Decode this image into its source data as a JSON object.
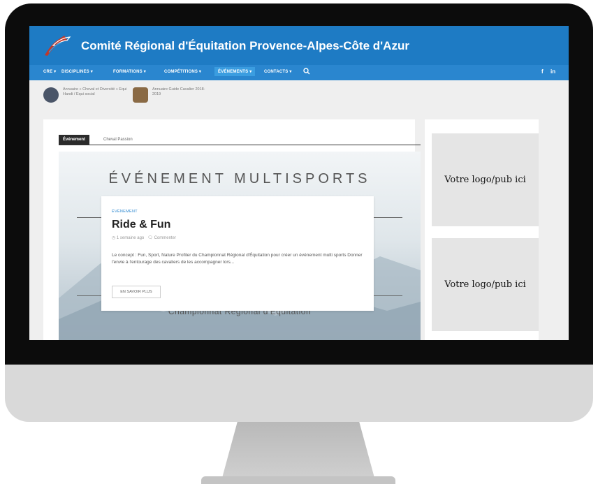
{
  "site": {
    "title": "Comité Régional d'Équitation Provence-Alpes-Côte d'Azur",
    "brand_color": "#1e7bc4"
  },
  "nav": {
    "items": [
      {
        "label": "CRE ▾",
        "active": false
      },
      {
        "label": "DISCIPLINES ▾",
        "active": false
      },
      {
        "label": "FORMATIONS ▾",
        "active": false
      },
      {
        "label": "COMPÉTITIONS ▾",
        "active": false
      },
      {
        "label": "ÉVÉNEMENTS ▾",
        "active": true
      },
      {
        "label": "CONTACTS ▾",
        "active": false
      }
    ],
    "search_icon": "search-icon",
    "social": [
      "f",
      "in"
    ]
  },
  "related": [
    {
      "text": "Annuaire « Cheval et Diversité » Equi Handi / Equi social"
    },
    {
      "text": "Annuaire Guide Cavalier 2018-2019"
    }
  ],
  "tabs": {
    "active": "Événement",
    "other": "Cheval Passion"
  },
  "hero": {
    "headline": "ÉVÉNEMENT MULTISPORTS",
    "subtitle": "Championnat Régional d'Équitation"
  },
  "post": {
    "category": "ÉVÉNEMENT",
    "title": "Ride & Fun",
    "time": "1 semaine ago",
    "comment": "Commenter",
    "excerpt": "Le concept : Fun, Sport, Nature Profiter du Championnat Régional d'Équitation pour créer un événement multi sports Donner l'envie à l'entourage des cavaliers de les accompagner lors...",
    "button": "EN SAVOIR PLUS"
  },
  "sidebar": {
    "ads": [
      "Votre logo/pub ici",
      "Votre logo/pub ici"
    ]
  }
}
